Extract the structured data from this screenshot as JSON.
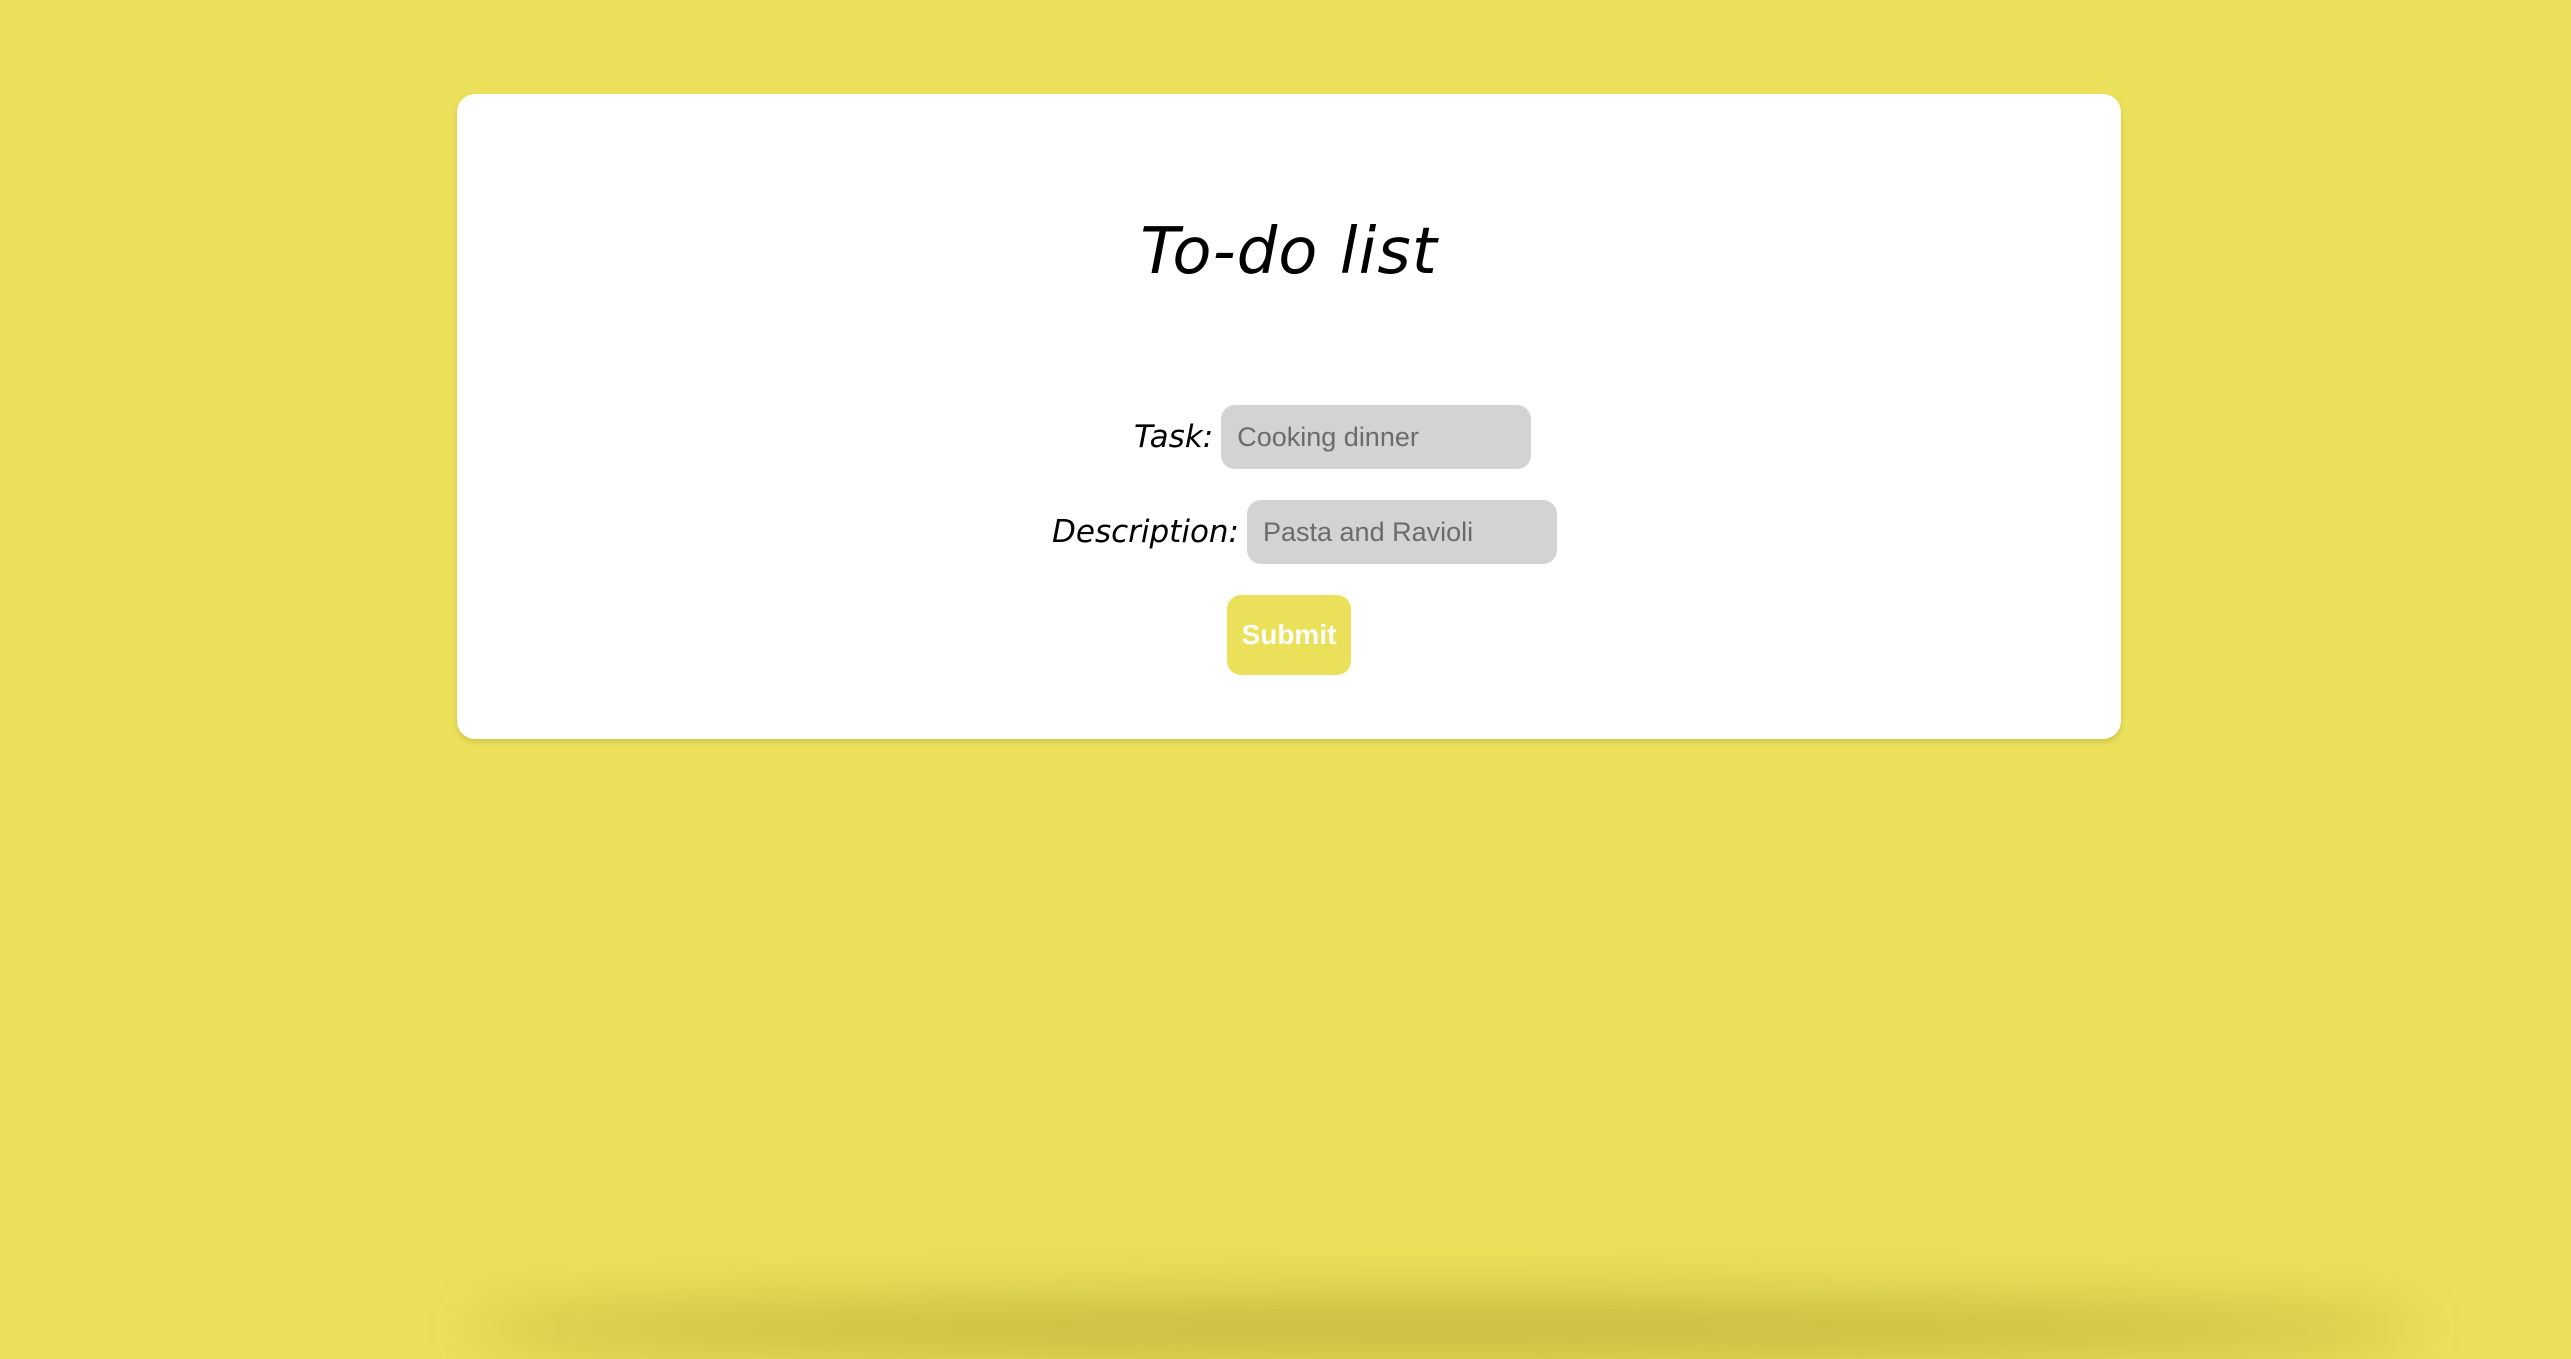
{
  "page": {
    "title": "To-do list",
    "background_color": "#ebe059",
    "card_color": "#ffffff"
  },
  "form": {
    "task": {
      "label": "Task:",
      "value": "",
      "placeholder": "Cooking dinner"
    },
    "description": {
      "label": "Description:",
      "value": "",
      "placeholder": "Pasta and Ravioli"
    },
    "submit_label": "Submit",
    "submit_color": "#ebe059",
    "field_color": "#d3d3d3"
  }
}
